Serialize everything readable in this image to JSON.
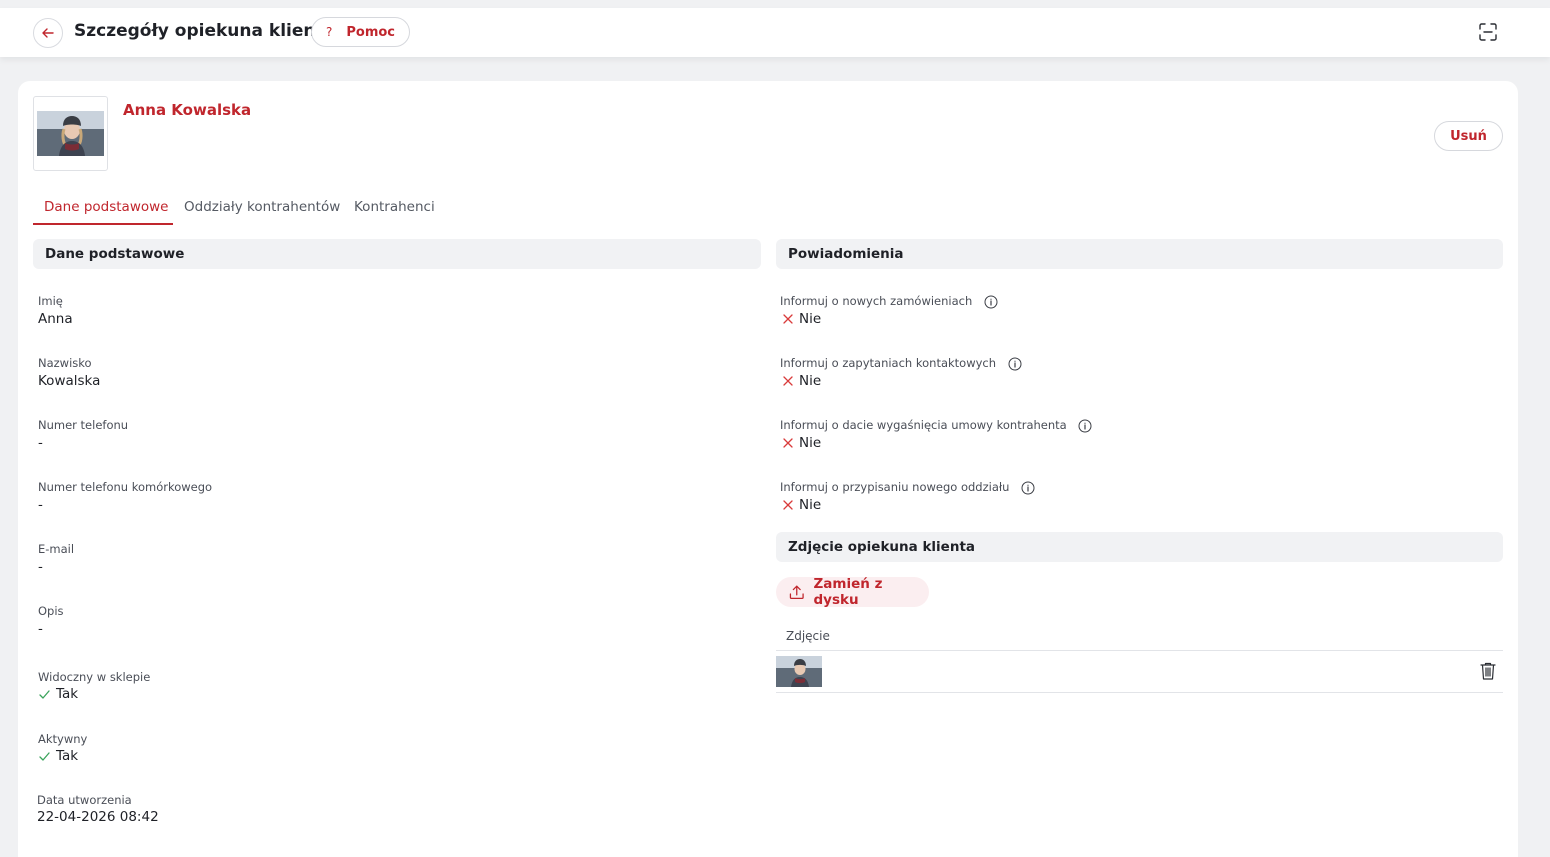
{
  "header": {
    "title": "Szczegóły opiekuna klienta",
    "help_label": "Pomoc",
    "help_icon": "question-mark-icon",
    "back_icon": "arrow-left-icon",
    "fullscreen_icon": "fullscreen-icon"
  },
  "profile": {
    "name": "Anna Kowalska",
    "delete_label": "Usuń"
  },
  "tabs": [
    {
      "label": "Dane podstawowe",
      "active": true
    },
    {
      "label": "Oddziały kontrahentów",
      "active": false
    },
    {
      "label": "Kontrahenci",
      "active": false
    }
  ],
  "basic": {
    "heading": "Dane podstawowe",
    "fields": [
      {
        "label": "Imię",
        "value": "Anna"
      },
      {
        "label": "Nazwisko",
        "value": "Kowalska"
      },
      {
        "label": "Numer telefonu",
        "value": "-"
      },
      {
        "label": "Numer telefonu komórkowego",
        "value": "-"
      },
      {
        "label": "E-mail",
        "value": "-"
      },
      {
        "label": "Opis",
        "value": "-"
      },
      {
        "label": "Widoczny w sklepie",
        "value": "Tak",
        "icon": "check-icon"
      },
      {
        "label": "Aktywny",
        "value": "Tak",
        "icon": "check-icon"
      },
      {
        "label": "Data utworzenia",
        "value": "22-04-2026 08:42"
      }
    ]
  },
  "notifications": {
    "heading": "Powiadomienia",
    "items": [
      {
        "label": "Informuj o nowych zamówieniach",
        "value": "Nie",
        "icon": "cross-icon"
      },
      {
        "label": "Informuj o zapytaniach kontaktowych",
        "value": "Nie",
        "icon": "cross-icon"
      },
      {
        "label": "Informuj o dacie wygaśnięcia umowy kontrahenta",
        "value": "Nie",
        "icon": "cross-icon"
      },
      {
        "label": "Informuj o przypisaniu nowego oddziału",
        "value": "Nie",
        "icon": "cross-icon"
      }
    ]
  },
  "photo": {
    "heading": "Zdjęcie opiekuna klienta",
    "upload_label": "Zamień z dysku",
    "upload_icon": "upload-icon",
    "column_label": "Zdjęcie",
    "delete_icon": "trash-icon"
  },
  "colors": {
    "accent": "#c0262d",
    "check": "#3aa35b",
    "cross": "#d93b3b",
    "section_bg": "#f1f2f4"
  }
}
